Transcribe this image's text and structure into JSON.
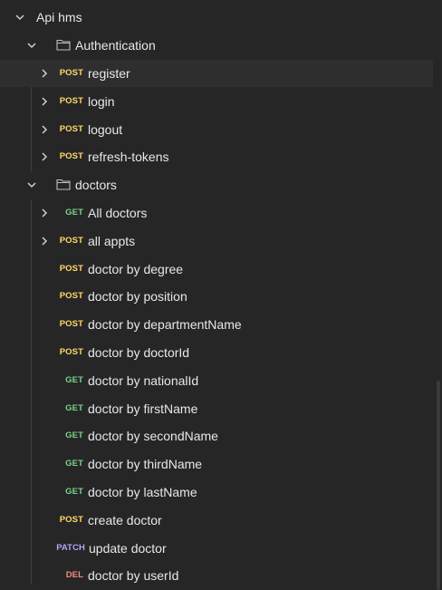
{
  "collection": {
    "name": "Api hms"
  },
  "folders": {
    "authentication": {
      "name": "Authentication"
    },
    "doctors": {
      "name": "doctors"
    }
  },
  "requests": {
    "register": {
      "method": "POST",
      "name": "register"
    },
    "login": {
      "method": "POST",
      "name": "login"
    },
    "logout": {
      "method": "POST",
      "name": "logout"
    },
    "refresh_tokens": {
      "method": "POST",
      "name": "refresh-tokens"
    },
    "all_doctors": {
      "method": "GET",
      "name": "All doctors"
    },
    "all_appts": {
      "method": "POST",
      "name": "all appts"
    },
    "doctor_by_degree": {
      "method": "POST",
      "name": "doctor by degree"
    },
    "doctor_by_position": {
      "method": "POST",
      "name": "doctor by position"
    },
    "doctor_by_departmentName": {
      "method": "POST",
      "name": "doctor by departmentName"
    },
    "doctor_by_doctorId": {
      "method": "POST",
      "name": "doctor by doctorId"
    },
    "doctor_by_nationalId": {
      "method": "GET",
      "name": "doctor by nationalId"
    },
    "doctor_by_firstName": {
      "method": "GET",
      "name": "doctor by firstName"
    },
    "doctor_by_secondName": {
      "method": "GET",
      "name": "doctor by secondName"
    },
    "doctor_by_thirdName": {
      "method": "GET",
      "name": "doctor by thirdName"
    },
    "doctor_by_lastName": {
      "method": "GET",
      "name": "doctor by lastName"
    },
    "create_doctor": {
      "method": "POST",
      "name": "create doctor"
    },
    "update_doctor": {
      "method": "PATCH",
      "name": "update doctor"
    },
    "doctor_by_userId": {
      "method": "DEL",
      "name": "doctor by userId"
    }
  },
  "colors": {
    "background": "#262626",
    "selected_row": "#2e2e2e",
    "post": "#ffd866",
    "get": "#7bd389",
    "patch": "#b9a3f4",
    "del": "#f08d81"
  },
  "icons": {
    "expanded": "chevron-down-icon",
    "collapsed": "chevron-right-icon",
    "folder": "folder-icon"
  }
}
